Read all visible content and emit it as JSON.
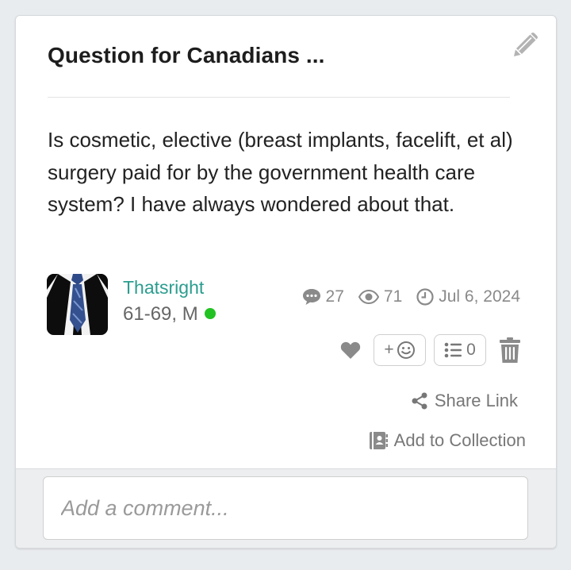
{
  "post": {
    "title": "Question for Canadians ...",
    "body": "Is cosmetic, elective (breast implants, facelift, et al) surgery paid for by the government health care system? I have always wondered about that."
  },
  "author": {
    "username": "Thatsright",
    "demographics": "61-69, M",
    "online": true
  },
  "stats": {
    "comments": "27",
    "views": "71",
    "date": "Jul 6, 2024"
  },
  "actions": {
    "react_label": "+",
    "list_count": "0",
    "share_label": "Share Link",
    "collection_label": "Add to Collection"
  },
  "comment": {
    "placeholder": "Add a comment..."
  },
  "icons": {
    "edit": "pencil-icon",
    "comments": "speech-bubble-icon",
    "views": "eye-icon",
    "date": "clock-icon",
    "like": "heart-icon",
    "react": "smiley-icon",
    "list": "list-icon",
    "delete": "trash-icon",
    "share": "share-icon",
    "collection": "collection-icon"
  },
  "colors": {
    "username": "#2a9d8f",
    "online": "#22c222",
    "muted": "#8a8a8a"
  }
}
